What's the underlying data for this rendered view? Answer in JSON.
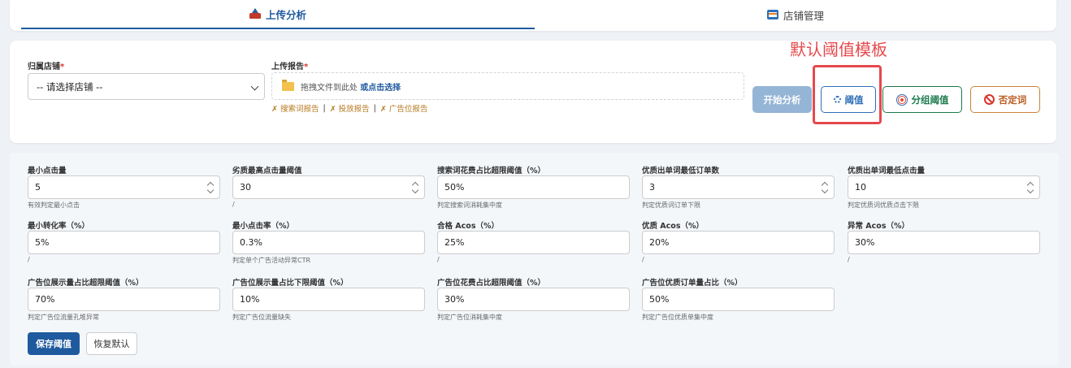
{
  "tabs": [
    {
      "label": "上传分析",
      "icon": "upload-icon",
      "active": true
    },
    {
      "label": "店铺管理",
      "icon": "store-icon",
      "active": false
    }
  ],
  "upload": {
    "store_label": "归属店铺",
    "store_value": "-- 请选择店铺 --",
    "report_label": "上传报告",
    "drop_text": "拖拽文件到此处",
    "drop_link": "或点击选择",
    "reports": [
      "✗ 搜索词报告",
      "✗ 投放报告",
      "✗ 广告位报告"
    ],
    "separator": "|",
    "required_mark": "*"
  },
  "actions": {
    "start": "开始分析",
    "threshold": "阈值",
    "group_threshold": "分组阈值",
    "negative": "否定词"
  },
  "annotation": {
    "text": "默认阈值模板",
    "color": "#e5494d"
  },
  "thresholds": {
    "fields": [
      {
        "label": "最小点击量",
        "value": "5",
        "hint": "有效判定最小点击",
        "spinner": true
      },
      {
        "label": "劣质最高点击量阈值",
        "value": "30",
        "hint": "/",
        "spinner": true
      },
      {
        "label": "搜索词花费占比超限阈值（%）",
        "value": "50%",
        "hint": "判定搜索词消耗集中度",
        "spinner": false
      },
      {
        "label": "优质出单词最低订单数",
        "value": "3",
        "hint": "判定优质词订单下限",
        "spinner": true
      },
      {
        "label": "优质出单词最低点击量",
        "value": "10",
        "hint": "判定优质词优质点击下限",
        "spinner": true
      },
      {
        "label": "最小转化率（%）",
        "value": "5%",
        "hint": "/",
        "spinner": false
      },
      {
        "label": "最小点击率（%）",
        "value": "0.3%",
        "hint": "判定单个广告活动异常CTR",
        "spinner": false
      },
      {
        "label": "合格 Acos（%）",
        "value": "25%",
        "hint": "/",
        "spinner": false
      },
      {
        "label": "优质 Acos（%）",
        "value": "20%",
        "hint": "/",
        "spinner": false
      },
      {
        "label": "异常 Acos（%）",
        "value": "30%",
        "hint": "/",
        "spinner": false
      },
      {
        "label": "广告位展示量占比超限阈值（%）",
        "value": "70%",
        "hint": "判定广告位流量孔堆异常",
        "spinner": false
      },
      {
        "label": "广告位展示量占比下限阈值（%）",
        "value": "10%",
        "hint": "判定广告位流量缺失",
        "spinner": false
      },
      {
        "label": "广告位花费占比超限阈值（%）",
        "value": "30%",
        "hint": "判定广告位消耗集中度",
        "spinner": false
      },
      {
        "label": "广告位优质订单量占比（%）",
        "value": "50%",
        "hint": "判定广告位优质单集中度",
        "spinner": false
      }
    ],
    "save": "保存阈值",
    "reset": "恢复默认"
  },
  "colors": {
    "primary": "#1f5a9e",
    "success": "#1b7a4b",
    "warning": "#c8843b",
    "danger": "#d9342b"
  }
}
